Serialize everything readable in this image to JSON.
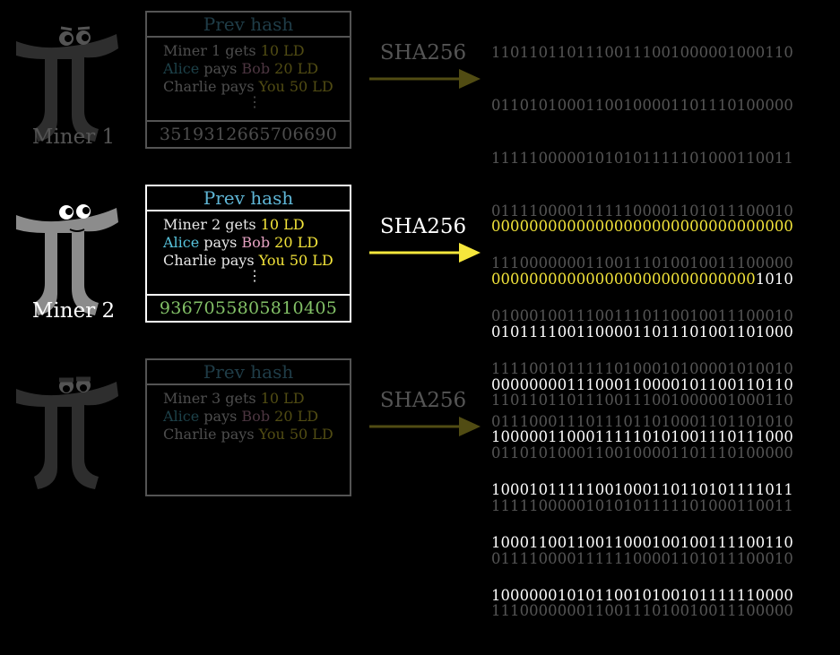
{
  "colors": {
    "prev_hash": "#5fb6d6",
    "amount": "#f3e43a",
    "alice": "#58c4dd",
    "bob": "#e5a2c2",
    "nonce": "#83c167",
    "arrow_active": "#f6e73c",
    "arrow_dim": "#5c5212"
  },
  "rows": [
    {
      "miner_label": "Miner 1",
      "prev_hash": "Prev hash",
      "tx1": {
        "pre": "Miner 1 gets ",
        "amount": "10 LD"
      },
      "tx2": {
        "payer": "Alice",
        "mid": " pays ",
        "payee": "Bob",
        "amount": " 20 LD"
      },
      "tx3": {
        "payer": "Charlie",
        "mid": " pays ",
        "payee": "You",
        "amount": " 50 LD"
      },
      "dots": "⋮",
      "nonce": "3519312665706690",
      "sha_label": "SHA256",
      "bits": [
        "11011011011100111001000001000110",
        "01101010001100100001101110100000",
        "11111000001010101111101000110011",
        "01111000011111100001101011100010",
        "11100000001100111010010011100000",
        "01000100111001110110010011100010",
        "11110010111110100010100001010010",
        "01110001110111011010001101101010"
      ]
    },
    {
      "miner_label": "Miner 2",
      "prev_hash": "Prev hash",
      "tx1": {
        "pre": "Miner 2 gets ",
        "amount": "10 LD"
      },
      "tx2": {
        "payer": "Alice",
        "mid": " pays ",
        "payee": "Bob",
        "amount": " 20 LD"
      },
      "tx3": {
        "payer": "Charlie",
        "mid": " pays ",
        "payee": "You",
        "amount": " 50 LD"
      },
      "dots": "⋮",
      "nonce": "9367055805810405",
      "sha_label": "SHA256",
      "bits_line1_zeros": "00000000000000000000000000000000",
      "bits_line2_zeros": "0000000000000000000000000000",
      "bits_line2_rest": "1010",
      "bits_rest": [
        "01011110011000011011101001101000",
        "00000000111000110000101100110110",
        "10000011000111110101001110111000",
        "10001011111001000110110101111011",
        "10001100110011000100100111100110",
        "10000001010110010100101111110000"
      ]
    },
    {
      "miner_label": "Miner 3",
      "prev_hash": "Prev hash",
      "tx1": {
        "pre": "Miner 3 gets ",
        "amount": "10 LD"
      },
      "tx2": {
        "payer": "Alice",
        "mid": " pays ",
        "payee": "Bob",
        "amount": " 20 LD"
      },
      "tx3": {
        "payer": "Charlie",
        "mid": " pays ",
        "payee": "You",
        "amount": " 50 LD"
      },
      "sha_label": "SHA256",
      "bits": [
        "11011011011100111001000001000110",
        "01101010001100100001101110100000",
        "11111000001010101111101000110011",
        "01111000011111100001101011100010",
        "11100000001100111010010011100000"
      ]
    }
  ]
}
